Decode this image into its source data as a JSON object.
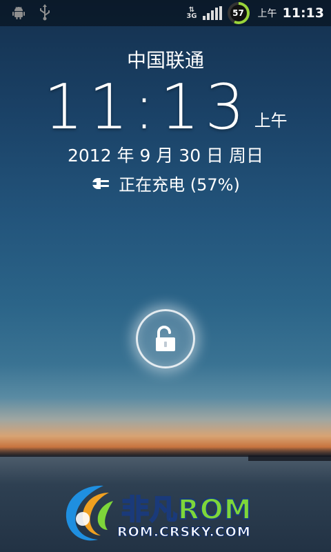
{
  "status_bar": {
    "left_icons": [
      "android-debug-icon",
      "usb-icon"
    ],
    "network_type": "3G",
    "signal_level": 4,
    "battery_percent": "57",
    "ampm": "上午",
    "time": "11:13",
    "colors": {
      "battery_ring": "#9ad43a"
    }
  },
  "lockscreen": {
    "carrier": "中国联通",
    "clock": "11:13",
    "clock_ampm": "上午",
    "date": "2012 年 9 月 30 日 周日",
    "charging_text": "正在充电 (57%)",
    "unlock_icon": "unlocked-padlock-icon"
  },
  "watermark": {
    "title_cn": "非凡",
    "title_rom": "ROM",
    "url": "ROM.CRSKY.COM"
  }
}
